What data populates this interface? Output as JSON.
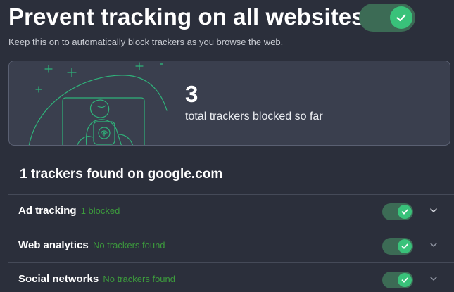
{
  "header": {
    "title": "Prevent tracking on all websites",
    "subtitle": "Keep this on to automatically block trackers as you browse the web.",
    "main_toggle": {
      "on": true
    }
  },
  "summary": {
    "total_count": "3",
    "total_label": "total trackers blocked so far"
  },
  "site": {
    "heading": "1 trackers found on google.com"
  },
  "categories": [
    {
      "label": "Ad tracking",
      "status": "1 blocked",
      "enabled": true,
      "icon": "chevron-down-icon"
    },
    {
      "label": "Web analytics",
      "status": "No trackers found",
      "enabled": true,
      "icon": "chevron-down-icon"
    },
    {
      "label": "Social networks",
      "status": "No trackers found",
      "enabled": true,
      "icon": "chevron-down-icon"
    }
  ],
  "colors": {
    "background": "#2b2f3b",
    "card": "#3a3f4e",
    "toggle_track": "#3c6b55",
    "toggle_knob": "#39c27a",
    "status_green": "#3c9a3c"
  }
}
